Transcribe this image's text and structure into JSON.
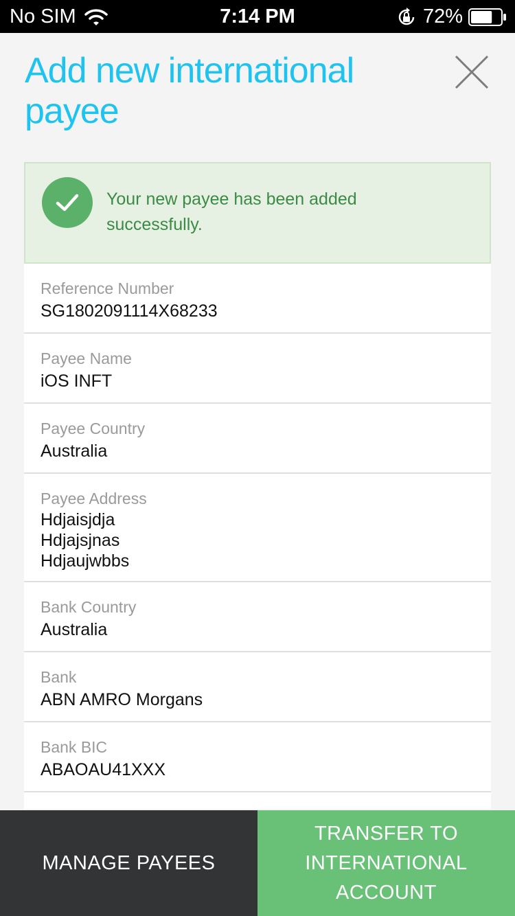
{
  "status_bar": {
    "carrier": "No SIM",
    "time": "7:14 PM",
    "battery": "72%",
    "battery_level": 0.72,
    "icons": [
      "wifi-icon",
      "orientation-lock-icon",
      "battery-icon"
    ]
  },
  "header": {
    "title": "Add new international payee",
    "close_icon": "close-icon"
  },
  "banner": {
    "icon": "check-circle-icon",
    "message": "Your new payee has been added successfully.",
    "color": "#3b8a45",
    "background": "#e7f1e3"
  },
  "details": [
    {
      "label": "Reference Number",
      "value": "SG1802091114X68233"
    },
    {
      "label": "Payee Name",
      "value": "iOS INFT"
    },
    {
      "label": "Payee Country",
      "value": "Australia"
    },
    {
      "label": "Payee Address",
      "lines": [
        "Hdjaisjdja",
        "Hdjajsjnas",
        "Hdjaujwbbs"
      ]
    },
    {
      "label": "Bank Country",
      "value": "Australia"
    },
    {
      "label": "Bank",
      "value": "ABN AMRO Morgans"
    },
    {
      "label": "Bank BIC",
      "value": "ABAOAU41XXX"
    }
  ],
  "actions": {
    "manage_label": "MANAGE PAYEES",
    "transfer_label": "TRANSFER TO INTERNATIONAL ACCOUNT"
  },
  "colors": {
    "accent": "#1fc3ef",
    "success": "#5cb16a",
    "primary_button": "#69c077",
    "secondary_button": "#333436"
  }
}
